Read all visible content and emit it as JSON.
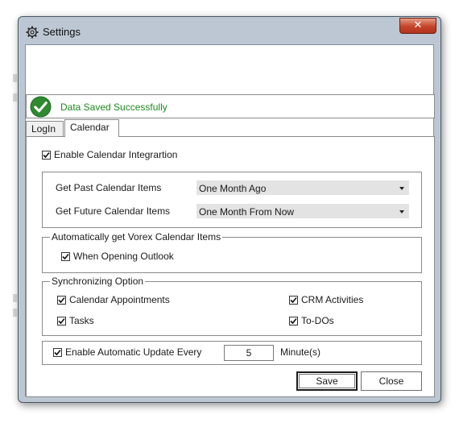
{
  "window": {
    "title": "Settings",
    "close_symbol": "✕",
    "title_icon": "gear-icon"
  },
  "status": {
    "message": "Data Saved Successfully",
    "icon": "check-circle-icon",
    "color": "#1d8a1d"
  },
  "tabs": [
    {
      "label": "LogIn",
      "selected": false
    },
    {
      "label": "Calendar",
      "selected": true
    }
  ],
  "calendar": {
    "enable_integration": {
      "label": "Enable Calendar Integrartion",
      "checked": true
    },
    "past_items": {
      "label": "Get Past Calendar Items",
      "value": "One Month Ago"
    },
    "future_items": {
      "label": "Get Future Calendar Items",
      "value": "One Month From Now"
    },
    "auto_group": {
      "legend": "Automatically get Vorex Calendar Items",
      "when_opening": {
        "label": "When Opening Outlook",
        "checked": true
      }
    },
    "sync_group": {
      "legend": "Synchronizing Option",
      "calendar_appointments": {
        "label": "Calendar Appointments",
        "checked": true
      },
      "crm_activities": {
        "label": "CRM Activities",
        "checked": true
      },
      "tasks": {
        "label": "Tasks",
        "checked": true
      },
      "todos": {
        "label": "To-DOs",
        "checked": true
      }
    },
    "auto_update": {
      "label": "Enable Automatic Update Every",
      "checked": true,
      "value": "5",
      "unit": "Minute(s)"
    }
  },
  "buttons": {
    "save": "Save",
    "close": "Close"
  }
}
